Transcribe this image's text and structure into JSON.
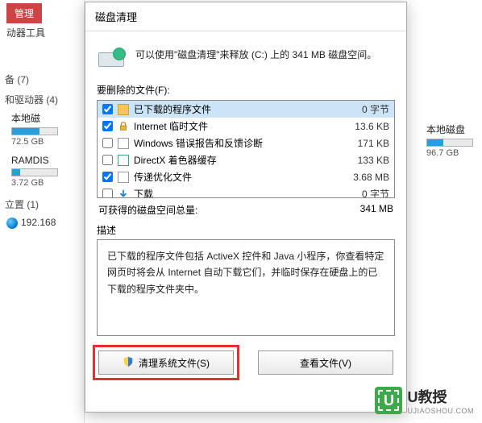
{
  "sidebar": {
    "manage_tab": "管理",
    "drive_tools": "动器工具",
    "devices_label": "备 (7)",
    "drives_label": "和驱动器 (4)",
    "drives": [
      {
        "label": "本地磁",
        "size": "72.5 GB",
        "fill": 60
      },
      {
        "label": "RAMDIS",
        "size": "3.72 GB",
        "fill": 18
      }
    ],
    "location_label": "立置 (1)",
    "network_item": "192.168"
  },
  "right_frag": {
    "label": "本地磁盘",
    "size": "96.7 GB",
    "fill": 35
  },
  "dialog": {
    "title": "磁盘清理",
    "intro": "可以使用\"磁盘清理\"来释放 (C:) 上的 341 MB 磁盘空间。",
    "files_label": "要删除的文件(F):",
    "files": [
      {
        "checked": true,
        "selected": true,
        "icon": "folder",
        "name": "已下载的程序文件",
        "size": "0 字节"
      },
      {
        "checked": true,
        "selected": false,
        "icon": "lock",
        "name": "Internet 临时文件",
        "size": "13.6 KB"
      },
      {
        "checked": false,
        "selected": false,
        "icon": "page",
        "name": "Windows 错误报告和反馈诊断",
        "size": "171 KB"
      },
      {
        "checked": false,
        "selected": false,
        "icon": "dx",
        "name": "DirectX 着色器缓存",
        "size": "133 KB"
      },
      {
        "checked": true,
        "selected": false,
        "icon": "opt",
        "name": "传递优化文件",
        "size": "3.68 MB"
      },
      {
        "checked": false,
        "selected": false,
        "icon": "down",
        "name": "下载",
        "size": "0 字节"
      }
    ],
    "total_label": "可获得的磁盘空间总量:",
    "total_value": "341 MB",
    "desc_label": "描述",
    "desc_text": "已下载的程序文件包括 ActiveX 控件和 Java 小程序，你查看特定网页时将会从 Internet 自动下载它们，并临时保存在硬盘上的已下载的程序文件夹中。",
    "btn_clean": "清理系统文件(S)",
    "btn_view": "查看文件(V)"
  },
  "watermark": {
    "badge": "U",
    "title": "U教授",
    "url": "UJIAOSHOU.COM"
  }
}
